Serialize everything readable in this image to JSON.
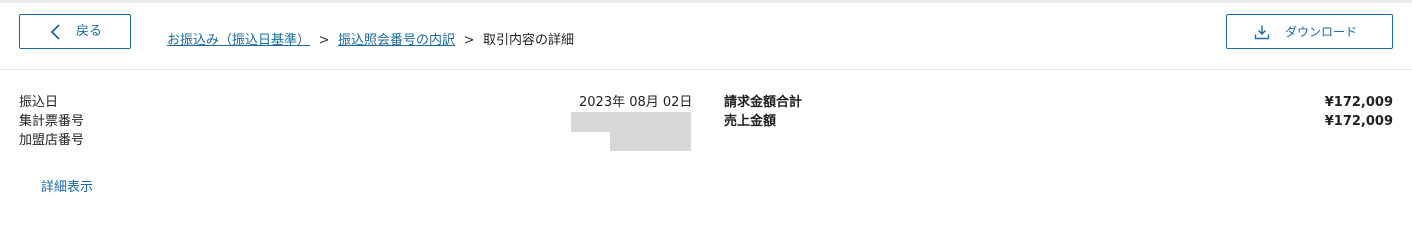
{
  "header": {
    "back_label": "戻る",
    "breadcrumb": {
      "items": [
        {
          "label": "お振込み（振込日基準）"
        },
        {
          "label": "振込照会番号の内訳"
        }
      ],
      "current": "取引内容の詳細",
      "separator": ">"
    },
    "download_label": "ダウンロード"
  },
  "details": {
    "labels": [
      "振込日",
      "集計票番号",
      "加盟店番号"
    ],
    "transfer_date": "2023年 08月 02日"
  },
  "summary": {
    "items": [
      {
        "label": "請求金額合計",
        "value": "¥172,009"
      },
      {
        "label": "売上金額",
        "value": "¥172,009"
      }
    ]
  },
  "detail_link_label": "詳細表示",
  "colors": {
    "accent": "#1c6aa0",
    "text": "#222222",
    "redacted": "#d7d7d7",
    "divider": "#e4e4e4"
  }
}
